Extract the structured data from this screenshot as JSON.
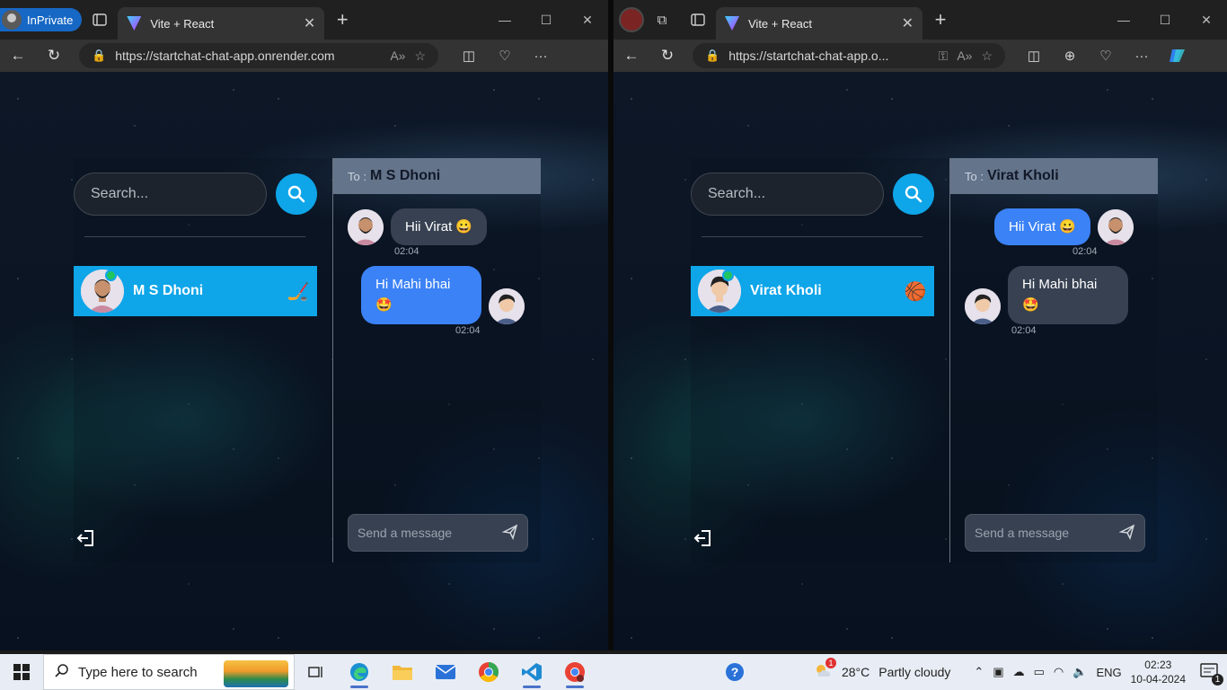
{
  "left_window": {
    "inprivate_label": "InPrivate",
    "tab_title": "Vite + React",
    "url": "https://startchat-chat-app.onrender.com",
    "search_placeholder": "Search...",
    "conversation": {
      "name": "M S Dhoni",
      "emoji": "🏒"
    },
    "chat": {
      "to_label": "To :",
      "to_name": "M S Dhoni",
      "messages": [
        {
          "text": "Hii Virat 😀",
          "time": "02:04",
          "side": "received"
        },
        {
          "text": "Hi Mahi bhai 🤩",
          "time": "02:04",
          "side": "sent"
        }
      ],
      "input_placeholder": "Send a message"
    }
  },
  "right_window": {
    "tab_title": "Vite + React",
    "url": "https://startchat-chat-app.o...",
    "search_placeholder": "Search...",
    "conversation": {
      "name": "Virat Kholi",
      "emoji": "🏀"
    },
    "chat": {
      "to_label": "To :",
      "to_name": "Virat Kholi",
      "messages": [
        {
          "text": "Hii Virat 😀",
          "time": "02:04",
          "side": "sent"
        },
        {
          "text": "Hi Mahi bhai 🤩",
          "time": "02:04",
          "side": "received"
        }
      ],
      "input_placeholder": "Send a message"
    }
  },
  "taskbar": {
    "search_placeholder": "Type here to search",
    "weather_temp": "28°C",
    "weather_text": "Partly cloudy",
    "weather_badge": "1",
    "language": "ENG",
    "time": "02:23",
    "date": "10-04-2024",
    "notification_count": "1"
  },
  "colors": {
    "accent": "#0ea5e9",
    "sent_bubble": "#3b82f6",
    "received_bubble": "#374151",
    "header": "#64748b",
    "online": "#22c55e"
  }
}
